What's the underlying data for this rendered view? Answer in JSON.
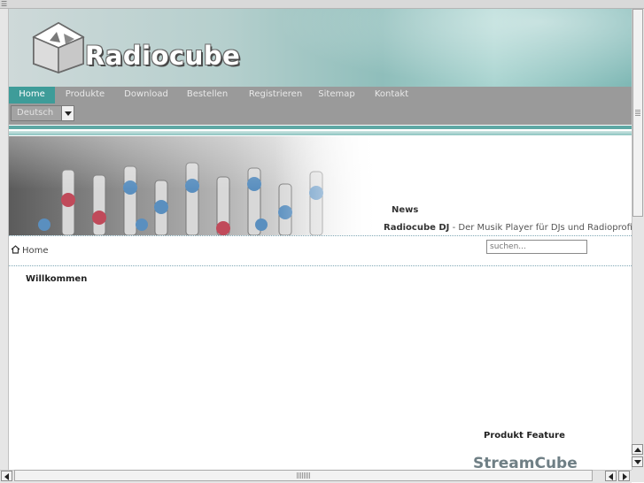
{
  "site": {
    "brand": "Radiocube",
    "logo_icon": "radiocube-cube-logo"
  },
  "nav": {
    "items": [
      {
        "label": "Home",
        "active": true
      },
      {
        "label": "Produkte",
        "active": false
      },
      {
        "label": "Download",
        "active": false
      },
      {
        "label": "Bestellen",
        "active": false
      },
      {
        "label": "Registrieren",
        "active": false
      },
      {
        "label": "Sitemap",
        "active": false
      },
      {
        "label": "Kontakt",
        "active": false
      }
    ],
    "active_color": "#3e9c99"
  },
  "language_select": {
    "value": "Deutsch"
  },
  "banner": {
    "image": "mixing-console-faders"
  },
  "news": {
    "title": "News",
    "item_bold": "Radiocube DJ",
    "item_text": " - Der Musik Player für DJs und Radioprofis"
  },
  "breadcrumb": {
    "home_label": "Home",
    "icon": "home-icon"
  },
  "search": {
    "placeholder": "suchen..."
  },
  "content": {
    "heading": "Willkommen"
  },
  "feature": {
    "title": "Produkt Feature",
    "product": "StreamCube"
  },
  "colors": {
    "accent": "#3e9c99",
    "nav_bg": "#9a9a9a"
  }
}
